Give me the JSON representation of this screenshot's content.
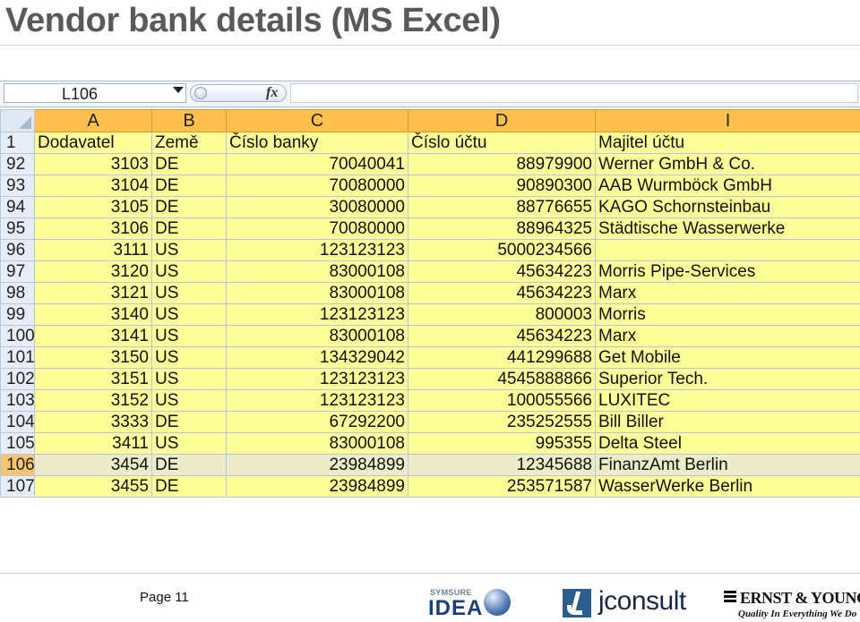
{
  "slide": {
    "title": "Vendor bank details (MS Excel)",
    "page_label": "Page 11"
  },
  "formula_bar": {
    "cell_ref": "L106",
    "fx_label": "fx",
    "formula": ""
  },
  "columns": [
    "A",
    "B",
    "C",
    "D",
    "I"
  ],
  "header_row": {
    "row_num": "1",
    "cells": [
      "Dodavatel",
      "Země",
      "Číslo banky",
      "Číslo účtu",
      "Majitel účtu"
    ]
  },
  "rows": [
    {
      "row_num": "92",
      "cells": [
        "3103",
        "DE",
        "70040041",
        "88979900",
        "Werner GmbH & Co."
      ]
    },
    {
      "row_num": "93",
      "cells": [
        "3104",
        "DE",
        "70080000",
        "90890300",
        "AAB Wurmböck GmbH"
      ]
    },
    {
      "row_num": "94",
      "cells": [
        "3105",
        "DE",
        "30080000",
        "88776655",
        "KAGO Schornsteinbau"
      ]
    },
    {
      "row_num": "95",
      "cells": [
        "3106",
        "DE",
        "70080000",
        "88964325",
        "Städtische Wasserwerke"
      ]
    },
    {
      "row_num": "96",
      "cells": [
        "3111",
        "US",
        "123123123",
        "5000234566",
        ""
      ]
    },
    {
      "row_num": "97",
      "cells": [
        "3120",
        "US",
        "83000108",
        "45634223",
        "Morris Pipe-Services"
      ]
    },
    {
      "row_num": "98",
      "cells": [
        "3121",
        "US",
        "83000108",
        "45634223",
        "Marx"
      ]
    },
    {
      "row_num": "99",
      "cells": [
        "3140",
        "US",
        "123123123",
        "800003",
        "Morris"
      ]
    },
    {
      "row_num": "100",
      "cells": [
        "3141",
        "US",
        "83000108",
        "45634223",
        "Marx"
      ]
    },
    {
      "row_num": "101",
      "cells": [
        "3150",
        "US",
        "134329042",
        "441299688",
        "Get Mobile"
      ]
    },
    {
      "row_num": "102",
      "cells": [
        "3151",
        "US",
        "123123123",
        "4545888866",
        "Superior Tech."
      ]
    },
    {
      "row_num": "103",
      "cells": [
        "3152",
        "US",
        "123123123",
        "100055566",
        "LUXITEC"
      ]
    },
    {
      "row_num": "104",
      "cells": [
        "3333",
        "DE",
        "67292200",
        "235252555",
        "Bill Biller"
      ]
    },
    {
      "row_num": "105",
      "cells": [
        "3411",
        "US",
        "83000108",
        "995355",
        "Delta Steel"
      ]
    },
    {
      "row_num": "106",
      "cells": [
        "3454",
        "DE",
        "23984899",
        "12345688",
        "FinanzAmt Berlin"
      ],
      "selected": true
    },
    {
      "row_num": "107",
      "cells": [
        "3455",
        "DE",
        "23984899",
        "253571587",
        "WasserWerke Berlin"
      ]
    }
  ],
  "logos": {
    "idea": {
      "sub": "SYMSURE",
      "main": "IDEA"
    },
    "jconsult": {
      "text": "jconsult"
    },
    "ey": {
      "name": "ERNST & YOUNG",
      "tagline": "Quality In Everything We Do"
    }
  },
  "colors": {
    "cell_fill": "#ffff99",
    "header_fill": "#ffc04d",
    "row_header_fill": "#e6edf6",
    "selected_row_fill": "#ececc8"
  }
}
